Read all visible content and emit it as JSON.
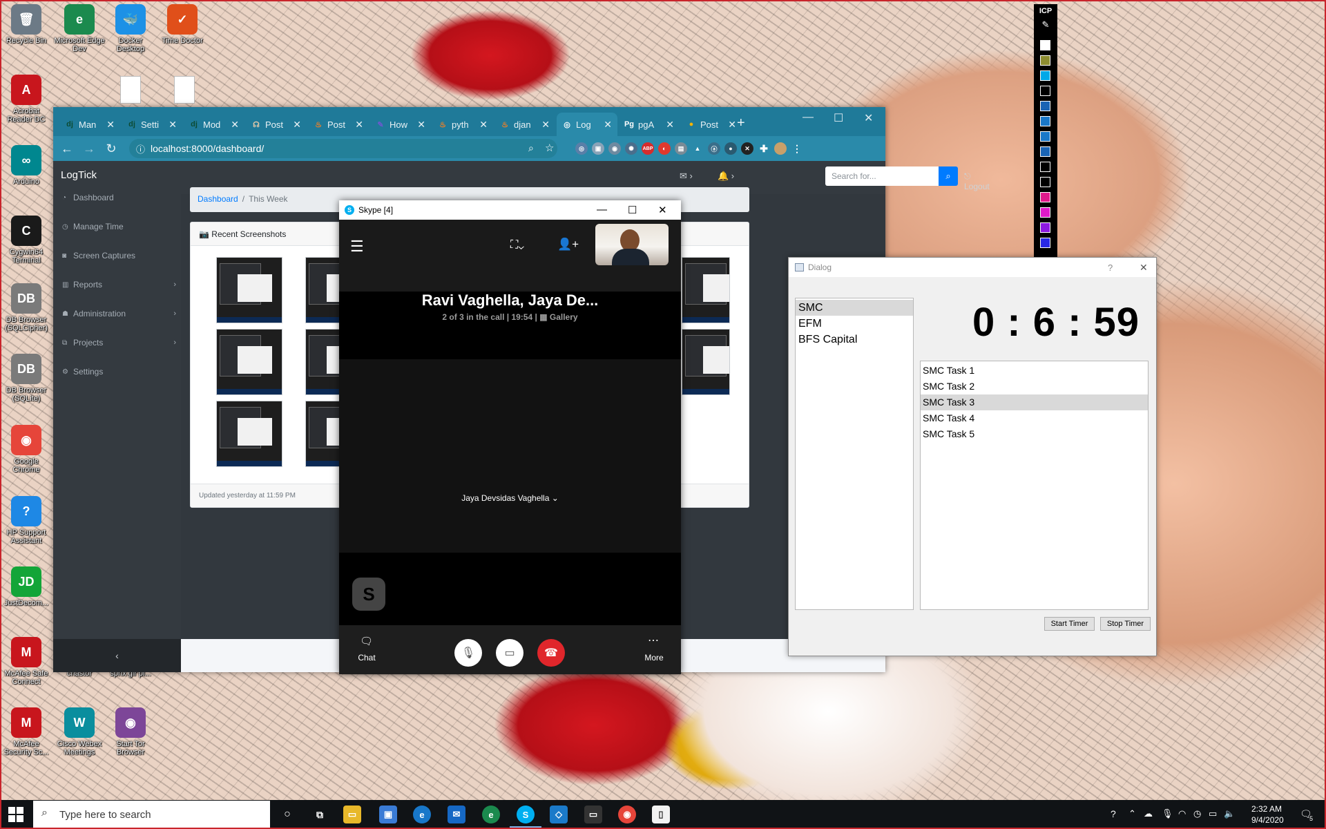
{
  "desktop": {
    "icons": [
      {
        "label": "Recycle Bin",
        "glyph": "🗑",
        "color": "#6c7a86"
      },
      {
        "label": "Microsoft Edge Dev",
        "glyph": "e",
        "color": "#1b8a4e"
      },
      {
        "label": "Docker Desktop",
        "glyph": "🐳",
        "color": "#1d91e6"
      },
      {
        "label": "Time Doctor",
        "glyph": "✓",
        "color": "#e04f1a"
      },
      {
        "label": "Acrobat Reader DC",
        "glyph": "A",
        "color": "#c8161d"
      },
      {
        "label": "Arduino",
        "glyph": "∞",
        "color": "#00878f"
      },
      {
        "label": "Cygwin64 Terminal",
        "glyph": "C",
        "color": "#1a1a1a"
      },
      {
        "label": "DB Browser (SQLCipher)",
        "glyph": "DB",
        "color": "#7a7a7a"
      },
      {
        "label": "DB Browser (SQLite)",
        "glyph": "DB",
        "color": "#7a7a7a"
      },
      {
        "label": "Google Chrome",
        "glyph": "◉",
        "color": "#e6453a"
      },
      {
        "label": "HP Support Assistant",
        "glyph": "?",
        "color": "#1e88e5"
      },
      {
        "label": "JustDecom...",
        "glyph": "JD",
        "color": "#13a538"
      },
      {
        "label": "McAfee Safe Connect",
        "glyph": "M",
        "color": "#c8161d"
      },
      {
        "label": "chastor",
        "glyph": "",
        "color": "rgba(0,0,0,0)"
      },
      {
        "label": "sphx glr pl...",
        "glyph": "",
        "color": "rgba(0,0,0,0)"
      },
      {
        "label": "McAfee Security Sc...",
        "glyph": "M",
        "color": "#c8161d"
      },
      {
        "label": "Cisco Webex Meetings",
        "glyph": "W",
        "color": "#0a8e9e"
      },
      {
        "label": "Start Tor Browser",
        "glyph": "◉",
        "color": "#7d4698"
      }
    ]
  },
  "browser": {
    "tabs": [
      {
        "icon": "dj",
        "label": "Man",
        "icon_color": "#0c4b33"
      },
      {
        "icon": "dj",
        "label": "Setti",
        "icon_color": "#0c4b33"
      },
      {
        "icon": "dj",
        "label": "Mod",
        "icon_color": "#0c4b33"
      },
      {
        "icon": "☊",
        "label": "Post",
        "icon_color": "#e6c9a8"
      },
      {
        "icon": "♨",
        "label": "Post",
        "icon_color": "#f48024"
      },
      {
        "icon": "✎",
        "label": "How",
        "icon_color": "#6a5acd"
      },
      {
        "icon": "♨",
        "label": "pyth",
        "icon_color": "#f48024"
      },
      {
        "icon": "♨",
        "label": "djan",
        "icon_color": "#f48024"
      },
      {
        "icon": "◎",
        "label": "Log",
        "icon_color": "#ffffff"
      },
      {
        "icon": "Pg",
        "label": "pgA",
        "icon_color": "#ffffff"
      },
      {
        "icon": "●",
        "label": "Post",
        "icon_color": "#f5b400"
      }
    ],
    "new_tab": "+",
    "url": "localhost:8000/dashboard/",
    "site": {
      "brand": "LogTick",
      "nav": [
        {
          "label": "Dashboard",
          "icon": "◔",
          "has_children": false
        },
        {
          "label": "Manage Time",
          "icon": "◷",
          "has_children": false
        },
        {
          "label": "Screen Captures",
          "icon": "◙",
          "has_children": false
        },
        {
          "label": "Reports",
          "icon": "▥",
          "has_children": true
        },
        {
          "label": "Administration",
          "icon": "☗",
          "has_children": true
        },
        {
          "label": "Projects",
          "icon": "⧉",
          "has_children": true
        },
        {
          "label": "Settings",
          "icon": "⚙",
          "has_children": false
        }
      ],
      "sidebar_toggle": "‹",
      "search_placeholder": "Search for...",
      "logout": "Logout",
      "breadcrumb": {
        "home": "Dashboard",
        "current": "This Week"
      },
      "card_title": "Recent Screenshots",
      "card_footer": "Updated yesterday at 11:59 PM"
    }
  },
  "skype": {
    "title": "Skype [4]",
    "call_name": "Ravi Vaghella, Jaya De...",
    "call_info": "2 of 3 in the call | 19:54 |",
    "view_mode": "Gallery",
    "caller": "Jaya Devsidas Vaghella",
    "avatar_letter": "S",
    "chat_label": "Chat",
    "more_label": "More"
  },
  "dialog": {
    "title": "Dialog",
    "help": "?",
    "close": "✕",
    "projects": [
      {
        "label": "SMC",
        "selected": true
      },
      {
        "label": "EFM",
        "selected": false
      },
      {
        "label": "BFS Capital",
        "selected": false
      }
    ],
    "timer": "0 : 6 : 59",
    "tasks": [
      {
        "label": "SMC Task 1",
        "selected": false
      },
      {
        "label": "SMC Task 2",
        "selected": false
      },
      {
        "label": "SMC Task 3",
        "selected": true
      },
      {
        "label": "SMC Task 4",
        "selected": false
      },
      {
        "label": "SMC Task 5",
        "selected": false
      }
    ],
    "start_button": "Start Timer",
    "stop_button": "Stop Timer"
  },
  "icp": {
    "label": "ICP",
    "swatches": [
      "#ffffff",
      "#8c8c30",
      "#00a8e8",
      "#000000",
      "#1a64b4",
      "#1a78c8",
      "#1a78c8",
      "#1a64b4",
      "#000000",
      "#000000",
      "#e0198c",
      "#e019c8",
      "#8c19e0",
      "#2828e6"
    ]
  },
  "taskbar": {
    "search_placeholder": "Type here to search",
    "time": "2:32 AM",
    "date": "9/4/2020",
    "notification_count": "5"
  }
}
